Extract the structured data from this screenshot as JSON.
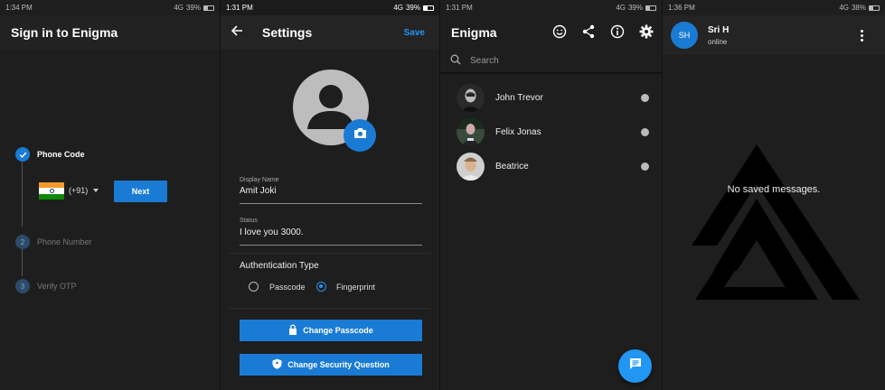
{
  "panel1": {
    "status": {
      "time": "1:34 PM",
      "network": "4G",
      "battery": "39%"
    },
    "title": "Sign in to Enigma",
    "steps": [
      {
        "label": "Phone Code",
        "state": "done"
      },
      {
        "label": "Phone Number",
        "number": "2",
        "state": "todo"
      },
      {
        "label": "Verify OTP",
        "number": "3",
        "state": "todo"
      }
    ],
    "country_code": "(+91)",
    "next_label": "Next"
  },
  "panel2": {
    "status": {
      "time": "1:31 PM",
      "network": "4G",
      "battery": "39%"
    },
    "title": "Settings",
    "save_label": "Save",
    "display_name_label": "Display Name",
    "display_name_value": "Amit Joki",
    "status_label": "Status",
    "status_value": "I love you 3000.",
    "auth_title": "Authentication Type",
    "auth_options": [
      {
        "label": "Passcode",
        "selected": false
      },
      {
        "label": "Fingerprint",
        "selected": true
      }
    ],
    "change_passcode_label": "Change Passcode",
    "change_question_label": "Change Security Question"
  },
  "panel3": {
    "status": {
      "time": "1:31 PM",
      "network": "4G",
      "battery": "39%"
    },
    "title": "Enigma",
    "search_placeholder": "Search",
    "chats": [
      {
        "name": "John Trevor"
      },
      {
        "name": "Felix Jonas"
      },
      {
        "name": "Beatrice"
      }
    ]
  },
  "panel4": {
    "status": {
      "time": "1:36 PM",
      "network": "4G",
      "battery": "38%"
    },
    "avatar_initials": "SH",
    "name": "Sri H",
    "presence": "online",
    "empty_text": "No saved messages."
  },
  "colors": {
    "accent": "#1a7bd4",
    "background": "#1e1e1e",
    "appbar": "#242424"
  }
}
